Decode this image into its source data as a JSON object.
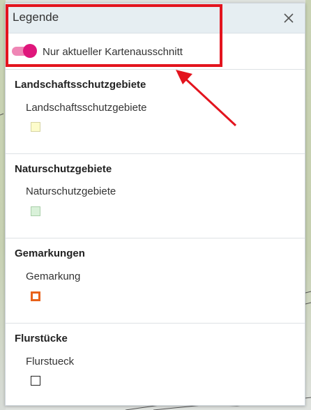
{
  "legend": {
    "title": "Legende",
    "close_icon": "close-icon",
    "toggle": {
      "label": "Nur aktueller Kartenausschnitt",
      "on": true,
      "color": "#df167b"
    }
  },
  "sections": [
    {
      "heading": "Landschaftsschutzgebiete",
      "item": "Landschaftsschutzgebiete",
      "swatch_fill": "#fdfccb",
      "swatch_border": "#d6d4a2"
    },
    {
      "heading": "Naturschutzgebiete",
      "item": "Naturschutzgebiete",
      "swatch_fill": "#d9f1d9",
      "swatch_border": "#a9cfa9"
    },
    {
      "heading": "Gemarkungen",
      "item": "Gemarkung",
      "swatch_fill": "#ffffff",
      "swatch_border": "#e8621a"
    },
    {
      "heading": "Flurstücke",
      "item": "Flurstueck",
      "swatch_fill": "#ffffff",
      "swatch_border": "#222222"
    }
  ],
  "annotation": {
    "color": "#e3141e"
  }
}
